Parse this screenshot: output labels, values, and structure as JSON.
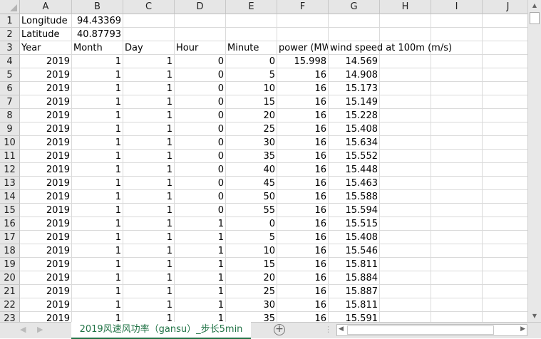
{
  "columns": [
    "A",
    "B",
    "C",
    "D",
    "E",
    "F",
    "G",
    "H",
    "I",
    "J"
  ],
  "rows": [
    {
      "n": "1",
      "cells": [
        "Longitude",
        "94.43369"
      ]
    },
    {
      "n": "2",
      "cells": [
        "Latitude",
        "40.87793"
      ]
    },
    {
      "n": "3",
      "cells": [
        "Year",
        "Month",
        "Day",
        "Hour",
        "Minute",
        "power (MW)",
        "wind speed at 100m (m/s)"
      ]
    },
    {
      "n": "4",
      "cells": [
        "2019",
        "1",
        "1",
        "0",
        "0",
        "15.998",
        "14.569"
      ]
    },
    {
      "n": "5",
      "cells": [
        "2019",
        "1",
        "1",
        "0",
        "5",
        "16",
        "14.908"
      ]
    },
    {
      "n": "6",
      "cells": [
        "2019",
        "1",
        "1",
        "0",
        "10",
        "16",
        "15.173"
      ]
    },
    {
      "n": "7",
      "cells": [
        "2019",
        "1",
        "1",
        "0",
        "15",
        "16",
        "15.149"
      ]
    },
    {
      "n": "8",
      "cells": [
        "2019",
        "1",
        "1",
        "0",
        "20",
        "16",
        "15.228"
      ]
    },
    {
      "n": "9",
      "cells": [
        "2019",
        "1",
        "1",
        "0",
        "25",
        "16",
        "15.408"
      ]
    },
    {
      "n": "10",
      "cells": [
        "2019",
        "1",
        "1",
        "0",
        "30",
        "16",
        "15.634"
      ]
    },
    {
      "n": "11",
      "cells": [
        "2019",
        "1",
        "1",
        "0",
        "35",
        "16",
        "15.552"
      ]
    },
    {
      "n": "12",
      "cells": [
        "2019",
        "1",
        "1",
        "0",
        "40",
        "16",
        "15.448"
      ]
    },
    {
      "n": "13",
      "cells": [
        "2019",
        "1",
        "1",
        "0",
        "45",
        "16",
        "15.463"
      ]
    },
    {
      "n": "14",
      "cells": [
        "2019",
        "1",
        "1",
        "0",
        "50",
        "16",
        "15.588"
      ]
    },
    {
      "n": "15",
      "cells": [
        "2019",
        "1",
        "1",
        "0",
        "55",
        "16",
        "15.594"
      ]
    },
    {
      "n": "16",
      "cells": [
        "2019",
        "1",
        "1",
        "1",
        "0",
        "16",
        "15.515"
      ]
    },
    {
      "n": "17",
      "cells": [
        "2019",
        "1",
        "1",
        "1",
        "5",
        "16",
        "15.408"
      ]
    },
    {
      "n": "18",
      "cells": [
        "2019",
        "1",
        "1",
        "1",
        "10",
        "16",
        "15.546"
      ]
    },
    {
      "n": "19",
      "cells": [
        "2019",
        "1",
        "1",
        "1",
        "15",
        "16",
        "15.811"
      ]
    },
    {
      "n": "20",
      "cells": [
        "2019",
        "1",
        "1",
        "1",
        "20",
        "16",
        "15.884"
      ]
    },
    {
      "n": "21",
      "cells": [
        "2019",
        "1",
        "1",
        "1",
        "25",
        "16",
        "15.887"
      ]
    },
    {
      "n": "22",
      "cells": [
        "2019",
        "1",
        "1",
        "1",
        "30",
        "16",
        "15.811"
      ]
    },
    {
      "n": "23",
      "cells": [
        "2019",
        "1",
        "1",
        "1",
        "35",
        "16",
        "15.591"
      ]
    }
  ],
  "sheet_tab": "2019风速风功率（gansu）_步长5min",
  "add_sheet": "+",
  "accent": "#217346"
}
